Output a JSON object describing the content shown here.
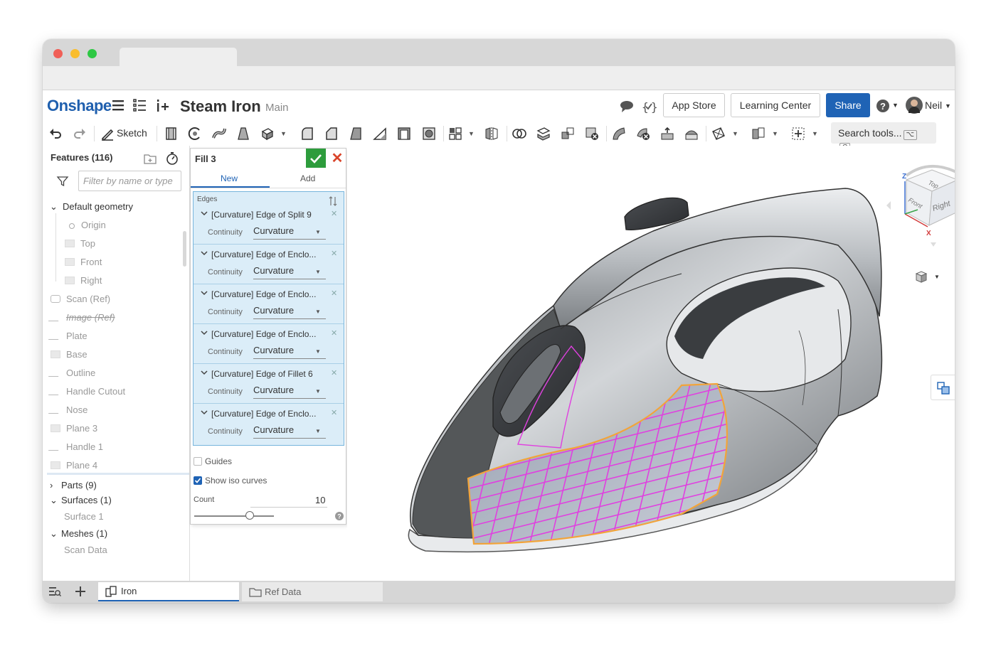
{
  "header": {
    "logo": "Onshape",
    "doc_title": "Steam Iron",
    "branch": "Main",
    "app_store": "App Store",
    "learning_center": "Learning Center",
    "share": "Share",
    "user": "Neil"
  },
  "toolbar": {
    "sketch": "Sketch",
    "search_label": "Search tools...",
    "search_key1": "⌥",
    "search_key2": "C"
  },
  "features": {
    "title": "Features (116)",
    "filter_placeholder": "Filter by name or type",
    "default_geometry": "Default geometry",
    "items": [
      "Origin",
      "Top",
      "Front",
      "Right",
      "Scan (Ref)",
      "Image (Ref)",
      "Plate",
      "Base",
      "Outline",
      "Handle Cutout",
      "Nose",
      "Plane 3",
      "Handle 1",
      "Plane 4"
    ],
    "parts": "Parts (9)",
    "surfaces": "Surfaces (1)",
    "surface_1": "Surface 1",
    "meshes": "Meshes (1)",
    "scan_data": "Scan Data"
  },
  "fill": {
    "title": "Fill 3",
    "tab_new": "New",
    "tab_add": "Add",
    "edges_label": "Edges",
    "continuity_label": "Continuity",
    "edges": [
      {
        "name": "[Curvature] Edge of Split 9",
        "continuity": "Curvature"
      },
      {
        "name": "[Curvature] Edge of Enclo...",
        "continuity": "Curvature"
      },
      {
        "name": "[Curvature] Edge of Enclo...",
        "continuity": "Curvature"
      },
      {
        "name": "[Curvature] Edge of Enclo...",
        "continuity": "Curvature"
      },
      {
        "name": "[Curvature] Edge of Fillet 6",
        "continuity": "Curvature"
      },
      {
        "name": "[Curvature] Edge of Enclo...",
        "continuity": "Curvature"
      }
    ],
    "guides": "Guides",
    "show_iso": "Show iso curves",
    "count_label": "Count",
    "count_value": "10",
    "slider_fraction": 0.7
  },
  "viewcube": {
    "top": "Top",
    "front": "Front",
    "right": "Right",
    "z": "Z",
    "x": "X"
  },
  "tabs": {
    "iron": "Iron",
    "ref_data": "Ref Data"
  },
  "colors": {
    "accent": "#1f63b5",
    "ok": "#2d9c3c",
    "cancel": "#d9442a",
    "iso": "#e040e0",
    "boundary": "#f2a43a"
  }
}
